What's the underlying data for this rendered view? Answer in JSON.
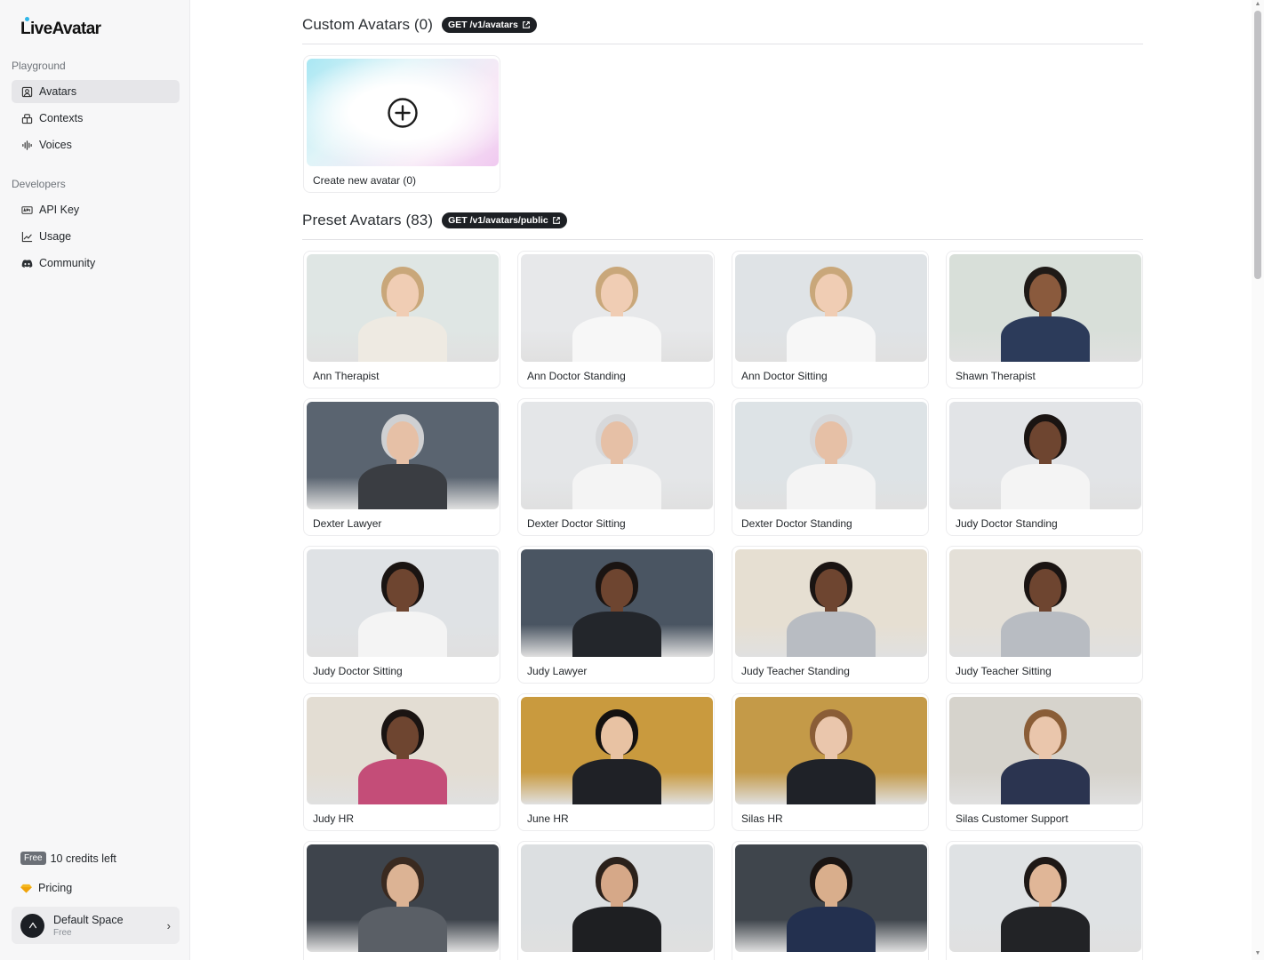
{
  "brand": {
    "name": "LiveAvatar",
    "accent": "#2fb6e8"
  },
  "sidebar": {
    "sections": [
      {
        "label": "Playground",
        "items": [
          {
            "label": "Avatars",
            "icon": "avatar-icon",
            "active": true
          },
          {
            "label": "Contexts",
            "icon": "contexts-icon",
            "active": false
          },
          {
            "label": "Voices",
            "icon": "voice-wave-icon",
            "active": false
          }
        ]
      },
      {
        "label": "Developers",
        "items": [
          {
            "label": "API Key",
            "icon": "api-key-icon",
            "active": false
          },
          {
            "label": "Usage",
            "icon": "chart-line-icon",
            "active": false
          },
          {
            "label": "Community",
            "icon": "discord-icon",
            "active": false
          }
        ]
      }
    ],
    "credits": {
      "badge": "Free",
      "text": "10 credits left"
    },
    "pricing": {
      "label": "Pricing",
      "icon": "gem-icon"
    },
    "space": {
      "name": "Default Space",
      "plan": "Free"
    }
  },
  "custom_section": {
    "title": "Custom Avatars (0)",
    "endpoint": "GET /v1/avatars",
    "create_label": "Create new avatar (0)"
  },
  "preset_section": {
    "title": "Preset Avatars (83)",
    "endpoint": "GET /v1/avatars/public",
    "avatars": [
      {
        "name": "Ann Therapist",
        "bg": "#dfe6e4",
        "hair": "#c9a77a",
        "skin": "#f0cdb4",
        "outfit": "#eeeae2"
      },
      {
        "name": "Ann Doctor Standing",
        "bg": "#e7e8ea",
        "hair": "#c9a77a",
        "skin": "#f0cdb4",
        "outfit": "#f7f7f7"
      },
      {
        "name": "Ann Doctor Sitting",
        "bg": "#dfe3e6",
        "hair": "#c9a77a",
        "skin": "#f0cdb4",
        "outfit": "#f7f7f7"
      },
      {
        "name": "Shawn Therapist",
        "bg": "#d8dfd9",
        "hair": "#1f1a17",
        "skin": "#8a5a3d",
        "outfit": "#2c3b5a"
      },
      {
        "name": "Dexter Lawyer",
        "bg": "#5a6470",
        "hair": "#cfd0d2",
        "skin": "#e6c0a6",
        "outfit": "#3a3d42"
      },
      {
        "name": "Dexter Doctor Sitting",
        "bg": "#e4e6e8",
        "hair": "#d7d8da",
        "skin": "#e6c0a6",
        "outfit": "#f4f4f4"
      },
      {
        "name": "Dexter Doctor Standing",
        "bg": "#dde3e6",
        "hair": "#d7d8da",
        "skin": "#e6c0a6",
        "outfit": "#f4f4f4"
      },
      {
        "name": "Judy Doctor Standing",
        "bg": "#e2e4e7",
        "hair": "#1a1412",
        "skin": "#6e4530",
        "outfit": "#f4f4f4"
      },
      {
        "name": "Judy Doctor Sitting",
        "bg": "#dfe2e5",
        "hair": "#1a1412",
        "skin": "#6e4530",
        "outfit": "#f4f4f4"
      },
      {
        "name": "Judy Lawyer",
        "bg": "#4a5562",
        "hair": "#1a1412",
        "skin": "#6e4530",
        "outfit": "#23262b"
      },
      {
        "name": "Judy Teacher Standing",
        "bg": "#e6dfd2",
        "hair": "#1a1412",
        "skin": "#6e4530",
        "outfit": "#b8bcc2"
      },
      {
        "name": "Judy Teacher Sitting",
        "bg": "#e4e0d8",
        "hair": "#1a1412",
        "skin": "#6e4530",
        "outfit": "#b8bcc2"
      },
      {
        "name": "Judy HR",
        "bg": "#e3ddd3",
        "hair": "#1a1412",
        "skin": "#6e4530",
        "outfit": "#c44d78"
      },
      {
        "name": "June HR",
        "bg": "#c99a3e",
        "hair": "#141110",
        "skin": "#e8c2a3",
        "outfit": "#1f2126"
      },
      {
        "name": "Silas HR",
        "bg": "#c49a48",
        "hair": "#8a5d37",
        "skin": "#eac6ac",
        "outfit": "#1f2228"
      },
      {
        "name": "Silas Customer Support",
        "bg": "#d6d3cc",
        "hair": "#8a5d37",
        "skin": "#eac6ac",
        "outfit": "#2b3450"
      },
      {
        "name": "",
        "bg": "#3e444c",
        "hair": "#3a2a20",
        "skin": "#dcb394",
        "outfit": "#5a5f66"
      },
      {
        "name": "",
        "bg": "#dcdfe1",
        "hair": "#2b211b",
        "skin": "#d6a888",
        "outfit": "#1e1f22"
      },
      {
        "name": "",
        "bg": "#3f454c",
        "hair": "#1a1412",
        "skin": "#d9ae8c",
        "outfit": "#23304f"
      },
      {
        "name": "",
        "bg": "#dfe2e4",
        "hair": "#1e1816",
        "skin": "#e0b697",
        "outfit": "#222326"
      }
    ]
  }
}
